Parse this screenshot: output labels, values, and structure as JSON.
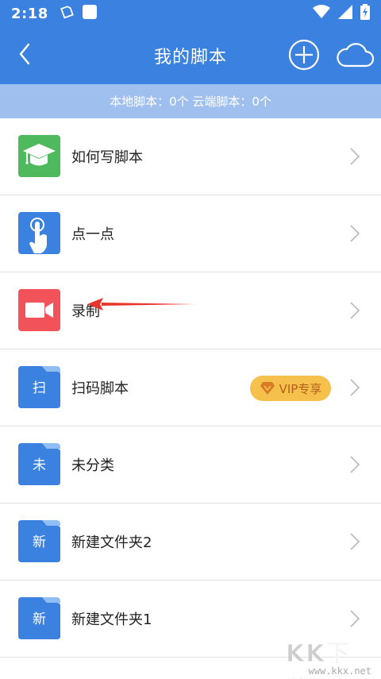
{
  "status_bar": {
    "time": "2:18",
    "icons": [
      "clipboard-icon",
      "square-icon",
      "wifi-icon",
      "signal-icon",
      "battery-charging-icon"
    ]
  },
  "header": {
    "title": "我的脚本",
    "back_icon": "chevron-left-icon",
    "add_icon": "circle-plus-icon",
    "cloud_icon": "cloud-icon"
  },
  "sub_bar": {
    "text": "本地脚本：0个 云端脚本：0个"
  },
  "list": {
    "items": [
      {
        "label": "如何写脚本",
        "icon": "graduation-cap-icon",
        "icon_color": "#4fba5d"
      },
      {
        "label": "点一点",
        "icon": "tap-finger-icon",
        "icon_color": "#3b82e0"
      },
      {
        "label": "录制",
        "icon": "video-camera-icon",
        "icon_color": "#f2535a"
      },
      {
        "label": "扫码脚本",
        "icon": "folder-icon",
        "folder_char": "扫",
        "badge": "VIP专享"
      },
      {
        "label": "未分类",
        "icon": "folder-icon",
        "folder_char": "未"
      },
      {
        "label": "新建文件夹2",
        "icon": "folder-icon",
        "folder_char": "新"
      },
      {
        "label": "新建文件夹1",
        "icon": "folder-icon",
        "folder_char": "新"
      }
    ]
  },
  "watermark": {
    "text": "KK下载",
    "url": "www.kkx.net"
  },
  "colors": {
    "primary": "#3b82e0",
    "sub_bar": "#9fc0ef",
    "vip_badge": "#f5c04c",
    "annotation_arrow": "#e8342b"
  }
}
